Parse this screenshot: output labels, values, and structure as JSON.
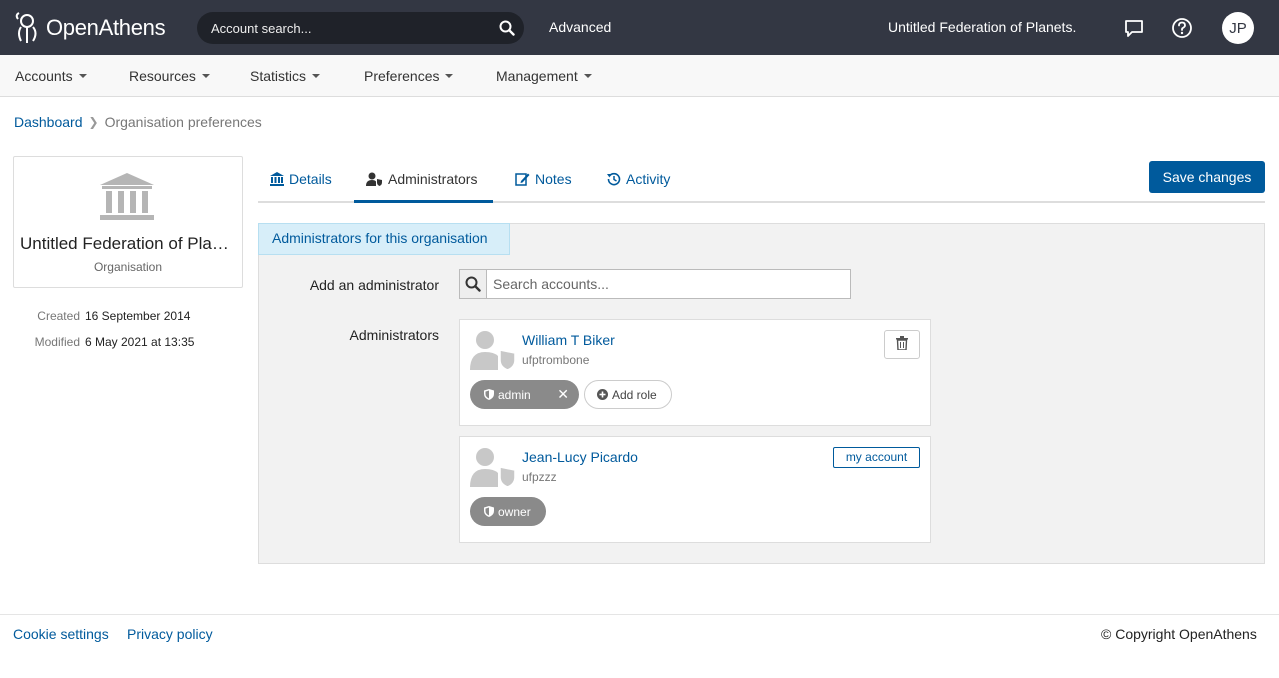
{
  "topbar": {
    "logo_text": "OpenAthens",
    "search_placeholder": "Account search...",
    "advanced_label": "Advanced",
    "org_name": "Untitled Federation of Planets.",
    "avatar_initials": "JP"
  },
  "menu": {
    "items": [
      "Accounts",
      "Resources",
      "Statistics",
      "Preferences",
      "Management"
    ]
  },
  "breadcrumb": {
    "root": "Dashboard",
    "current": "Organisation preferences"
  },
  "org_card": {
    "name": "Untitled Federation of Planets.",
    "type": "Organisation",
    "created_label": "Created",
    "created_value": "16 September 2014",
    "modified_label": "Modified",
    "modified_value": "6 May 2021 at 13:35"
  },
  "tabs": [
    {
      "label": "Details",
      "icon": "bank-icon"
    },
    {
      "label": "Administrators",
      "icon": "user-shield-icon"
    },
    {
      "label": "Notes",
      "icon": "edit-icon"
    },
    {
      "label": "Activity",
      "icon": "history-icon"
    }
  ],
  "active_tab": "Administrators",
  "save_label": "Save changes",
  "panel": {
    "heading": "Administrators for this organisation",
    "add_label": "Add an administrator",
    "search_placeholder": "Search accounts...",
    "admins_label": "Administrators",
    "admins": [
      {
        "name": "William T Biker",
        "username": "ufptrombone",
        "role": "admin",
        "add_role_label": "Add role"
      },
      {
        "name": "Jean-Lucy Picardo",
        "username": "ufpzzz",
        "role": "owner",
        "badge": "my account"
      }
    ]
  },
  "footer": {
    "cookie_label": "Cookie settings",
    "privacy_label": "Privacy policy",
    "copyright": "© Copyright OpenAthens"
  },
  "colors": {
    "topbar": "#333743",
    "accent": "#005a9c",
    "role_pill": "#8a8a8a"
  }
}
